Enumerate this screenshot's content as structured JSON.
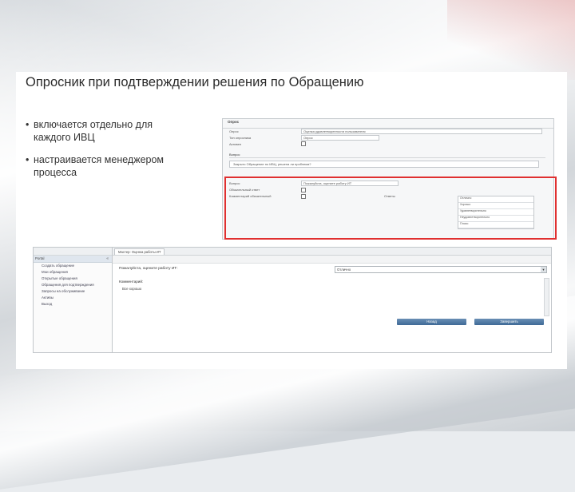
{
  "slide": {
    "title": "Опросник при подтверждении решения по Обращению",
    "bullets": [
      "включается отдельно для каждого ИВЦ",
      "настраивается менеджером процесса"
    ]
  },
  "top_screenshot": {
    "header": "Опрос",
    "fields": [
      {
        "label": "Опрос",
        "value": "Оценка удовлетворенности пользователя"
      },
      {
        "label": "Тип опросника",
        "value": "Опрос"
      },
      {
        "label": "Активен",
        "value": ""
      }
    ],
    "section_question": "Вопрос",
    "question_text": "Закрыто Обращение по ИВЦ, решена ли проблема?",
    "fields2": [
      {
        "label": "Вопрос",
        "value": "Пожалуйста, оцените работу ИТ"
      },
      {
        "label": "Обязательный ответ",
        "value": ""
      },
      {
        "label": "Комментарий обязательный",
        "value": ""
      }
    ],
    "answers_label": "Ответы",
    "answers": [
      "Отлично",
      "Хорошо",
      "Удовлетворительно",
      "Неудовлетворительно",
      "Плохо"
    ]
  },
  "bottom_screenshot": {
    "nav_header": "Portal",
    "nav_items": [
      "Создать обращение",
      "Мои обращения",
      "Открытые обращения",
      "Обращения для подтверждения",
      "Запросы на обслуживание",
      "Активы",
      "Выход"
    ],
    "tab_label": "Мастер: Оценка работы ИТ",
    "question": "Пожалуйста, оцените работу ИТ:",
    "selected_value": "Отлично",
    "comment_label": "Комментарий:",
    "comment_text": "Все хорошо",
    "buttons": [
      "Назад",
      "Завершить"
    ]
  },
  "colors": {
    "highlight": "#e03030",
    "button": "#4a74a0"
  }
}
